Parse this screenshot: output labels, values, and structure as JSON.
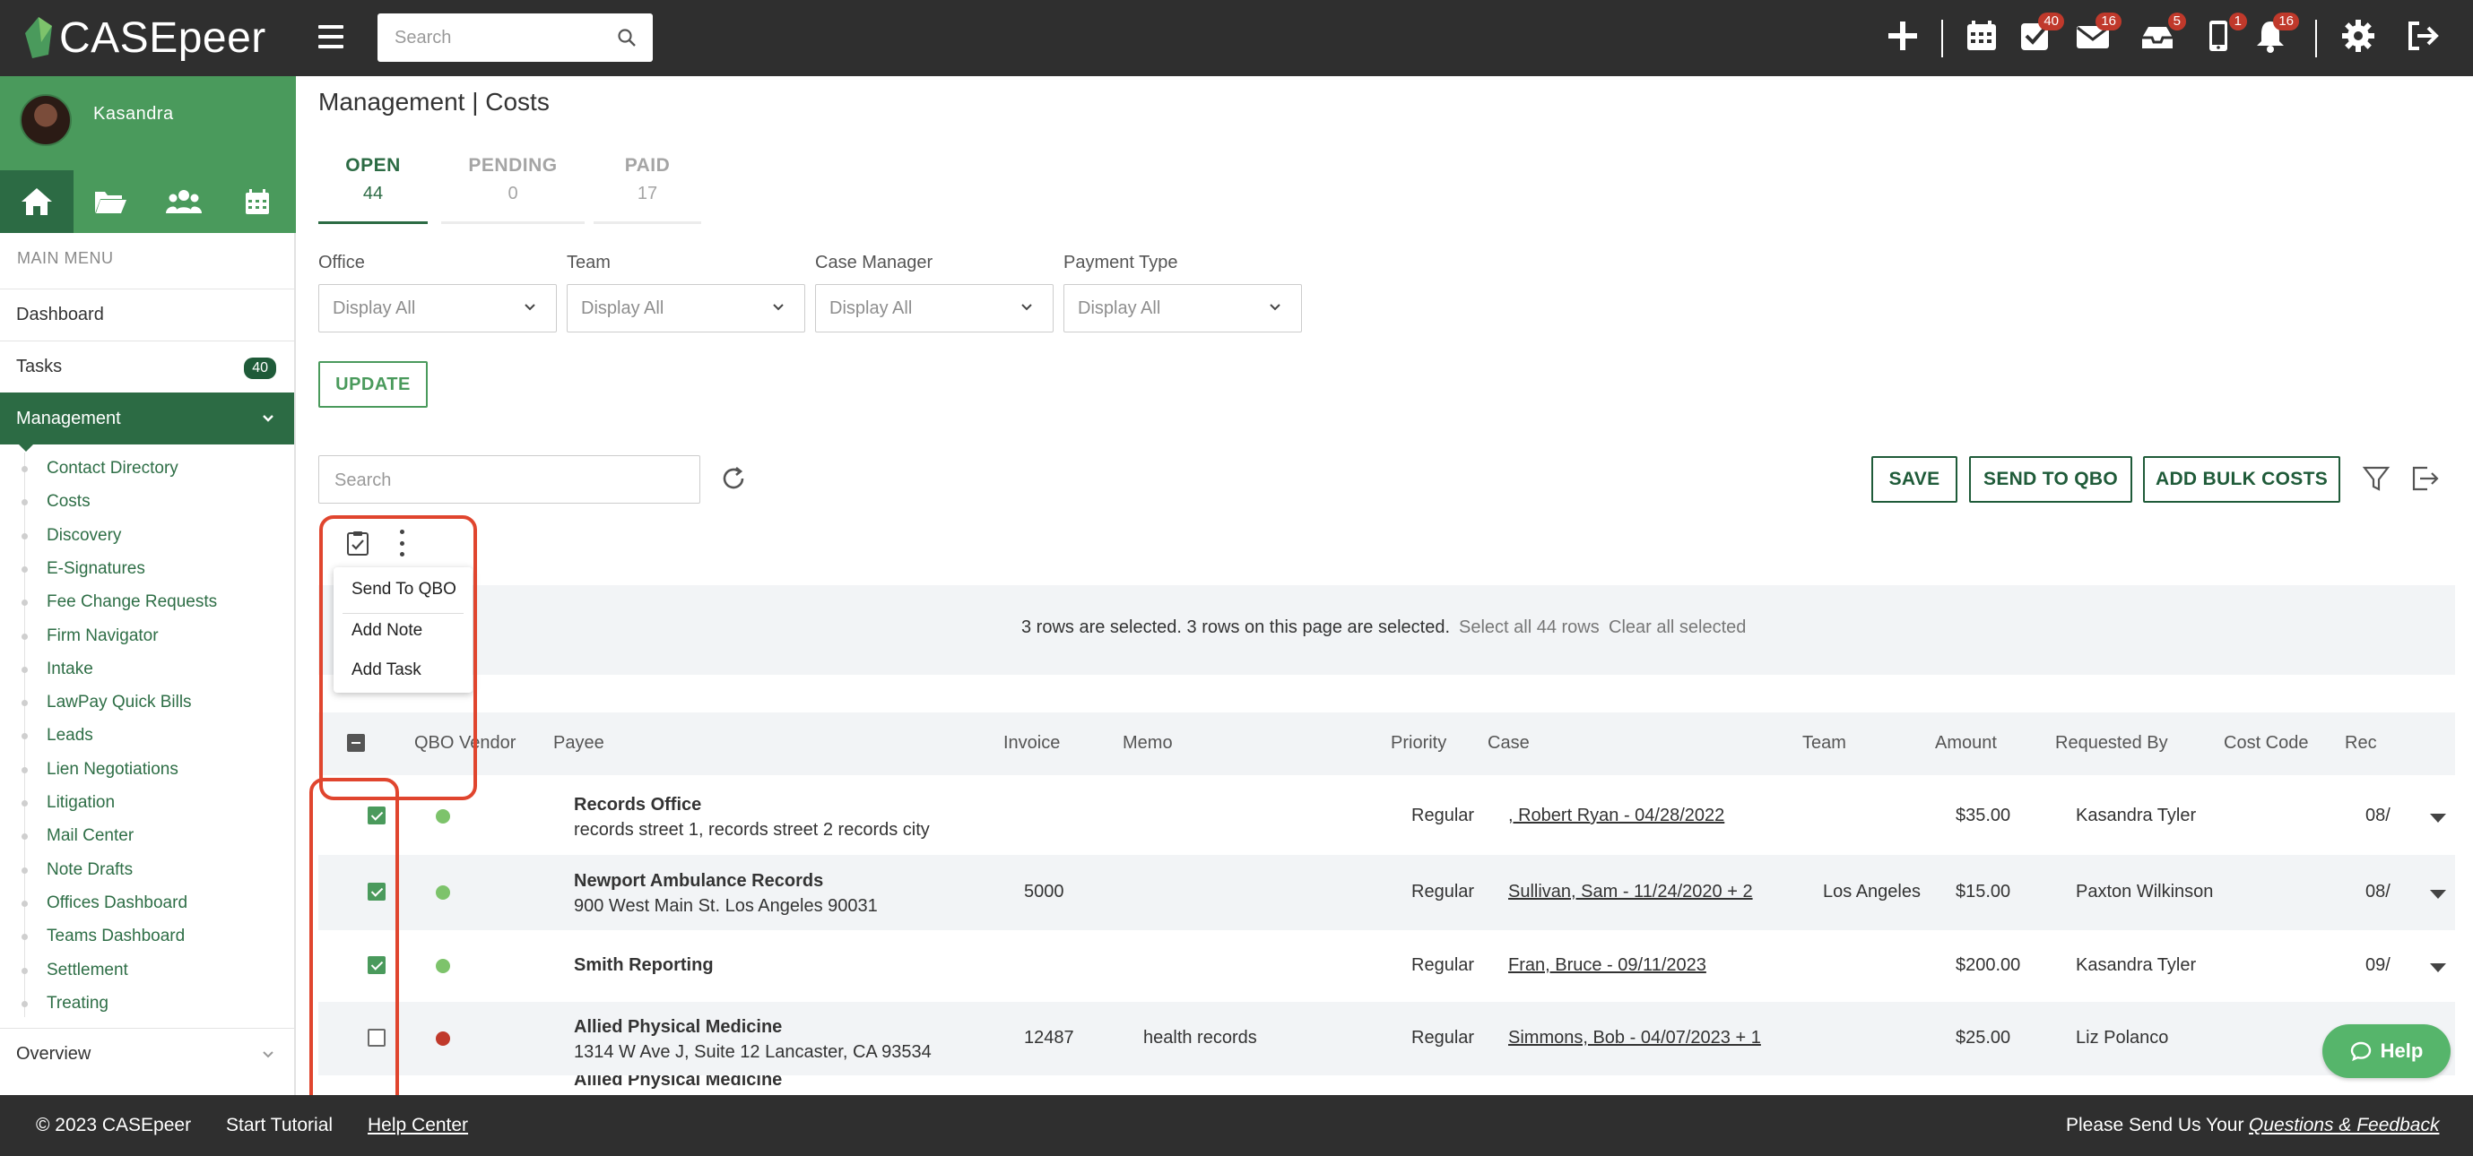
{
  "app": {
    "brand": "CASEpeer",
    "accent": "#4a9a5c",
    "accent_dark": "#2c6b44"
  },
  "topbar": {
    "search_placeholder": "Search",
    "icons": [
      {
        "name": "plus-icon"
      },
      {
        "name": "calendar-icon"
      },
      {
        "name": "tasks-icon",
        "badge": "40"
      },
      {
        "name": "mail-icon",
        "badge": "16"
      },
      {
        "name": "inbox-icon",
        "badge": "5"
      },
      {
        "name": "phone-icon",
        "badge": "1"
      },
      {
        "name": "bell-icon",
        "badge": "16"
      },
      {
        "name": "gear-icon"
      },
      {
        "name": "logout-icon"
      }
    ]
  },
  "sidebar": {
    "username": "Kasandra",
    "menu_heading": "MAIN MENU",
    "dashboard": "Dashboard",
    "tasks": "Tasks",
    "tasks_count": "40",
    "management": "Management",
    "overview": "Overview",
    "sub_items": [
      "Contact Directory",
      "Costs",
      "Discovery",
      "E-Signatures",
      "Fee Change Requests",
      "Firm Navigator",
      "Intake",
      "LawPay Quick Bills",
      "Leads",
      "Lien Negotiations",
      "Litigation",
      "Mail Center",
      "Note Drafts",
      "Offices Dashboard",
      "Teams Dashboard",
      "Settlement",
      "Treating"
    ]
  },
  "main": {
    "title": "Management | Costs",
    "tabs": [
      {
        "label": "OPEN",
        "count": "44"
      },
      {
        "label": "PENDING",
        "count": "0"
      },
      {
        "label": "PAID",
        "count": "17"
      }
    ],
    "filters": [
      {
        "label": "Office",
        "value": "Display All"
      },
      {
        "label": "Team",
        "value": "Display All"
      },
      {
        "label": "Case Manager",
        "value": "Display All"
      },
      {
        "label": "Payment Type",
        "value": "Display All"
      }
    ],
    "update_label": "UPDATE",
    "search_placeholder": "Search",
    "buttons": {
      "save": "SAVE",
      "send_qbo": "SEND TO QBO",
      "add_bulk": "ADD BULK COSTS"
    },
    "bulk_menu": [
      "Send To QBO",
      "Add Note",
      "Add Task"
    ],
    "selection": {
      "text": "3 rows are selected. 3 rows on this page are selected.",
      "select_all": "Select all 44 rows",
      "clear": "Clear all selected"
    },
    "columns": [
      "QBO Vendor",
      "Payee",
      "Invoice",
      "Memo",
      "Priority",
      "Case",
      "Team",
      "Amount",
      "Requested By",
      "Cost Code",
      "Rec"
    ],
    "rows": [
      {
        "checked": true,
        "vendor_color": "#7dc36b",
        "payee": "Records Office",
        "address": "records street 1, records street 2 records city",
        "invoice": "",
        "memo": "",
        "priority": "Regular",
        "case": ", Robert Ryan - 04/28/2022",
        "team": "",
        "amount": "$35.00",
        "requested_by": "Kasandra Tyler",
        "rec": "08/"
      },
      {
        "checked": true,
        "vendor_color": "#7dc36b",
        "payee": "Newport Ambulance Records",
        "address": "900 West Main St. Los Angeles 90031",
        "invoice": "5000",
        "memo": "",
        "priority": "Regular",
        "case": "Sullivan, Sam - 11/24/2020 + 2",
        "team": "Los Angeles",
        "amount": "$15.00",
        "requested_by": "Paxton Wilkinson",
        "rec": "08/"
      },
      {
        "checked": true,
        "vendor_color": "#7dc36b",
        "payee": "Smith Reporting",
        "address": "",
        "invoice": "",
        "memo": "",
        "priority": "Regular",
        "case": "Fran, Bruce - 09/11/2023",
        "team": "",
        "amount": "$200.00",
        "requested_by": "Kasandra Tyler",
        "rec": "09/"
      },
      {
        "checked": false,
        "vendor_color": "#c0392b",
        "payee": "Allied Physical Medicine",
        "address": "1314 W Ave J, Suite 12 Lancaster, CA 93534",
        "invoice": "12487",
        "memo": "health records",
        "priority": "Regular",
        "case": "Simmons, Bob - 04/07/2023 + 1",
        "team": "",
        "amount": "$25.00",
        "requested_by": "Liz Polanco",
        "rec": ""
      }
    ],
    "partial_row_payee": "Allied Physical Medicine"
  },
  "help": {
    "label": "Help"
  },
  "footer": {
    "copyright": "© 2023 CASEpeer",
    "tutorial": "Start Tutorial",
    "help_center": "Help Center",
    "send_us": "Please Send Us Your",
    "feedback": "Questions & Feedback"
  }
}
